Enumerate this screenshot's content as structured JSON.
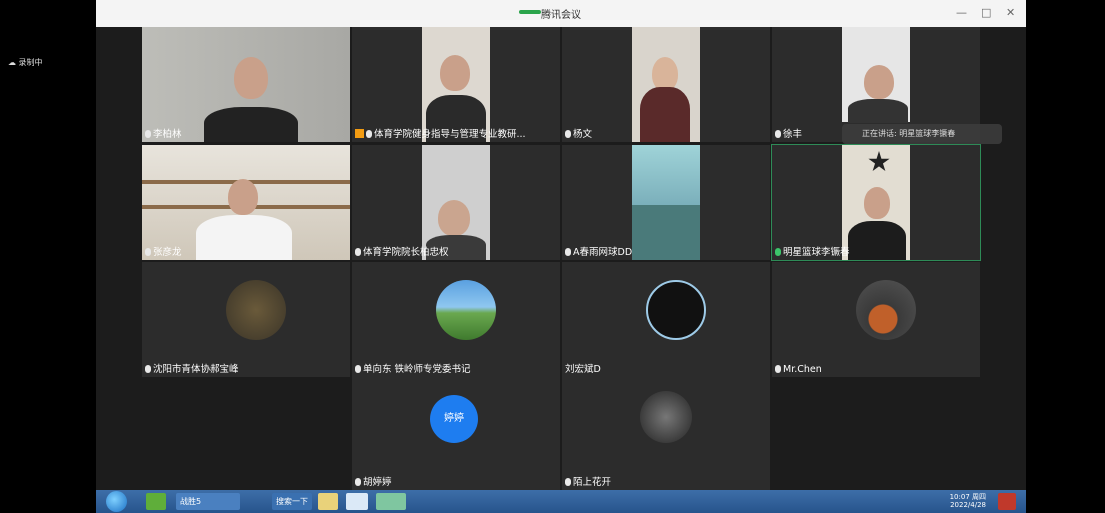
{
  "window": {
    "title": "腾讯会议",
    "minimize": "—",
    "maximize": "ά",
    "close": "✕"
  },
  "status": {
    "recording": "录制中"
  },
  "speaking": "正在讲话: 明星篮球李镢春",
  "participants": [
    {
      "name": "李柏林"
    },
    {
      "name": "体育学院健身指导与管理专业教研..."
    },
    {
      "name": "杨文"
    },
    {
      "name": "徐丰"
    },
    {
      "name": "张彦龙"
    },
    {
      "name": "体育学院院长柏忠权"
    },
    {
      "name": "A春雨网球DD"
    },
    {
      "name": "明星篮球李镢春"
    },
    {
      "name": "沈阳市青体协郝宝峰"
    },
    {
      "name": "单向东 铁岭师专党委书记"
    },
    {
      "name": "刘宏斌D"
    },
    {
      "name": "Mr.Chen"
    },
    {
      "name": "胡婷婷",
      "avatar_text": "婷婷"
    },
    {
      "name": "陌上花开"
    }
  ],
  "taskbar": {
    "items": [
      "战胜5",
      "搜索一下"
    ],
    "clock_time": "10:07 周四",
    "clock_date": "2022/4/28"
  },
  "colors": {
    "accent": "#2aa34a",
    "tile_bg": "#2c2c2c",
    "avatar_blue": "#1e7df0"
  }
}
